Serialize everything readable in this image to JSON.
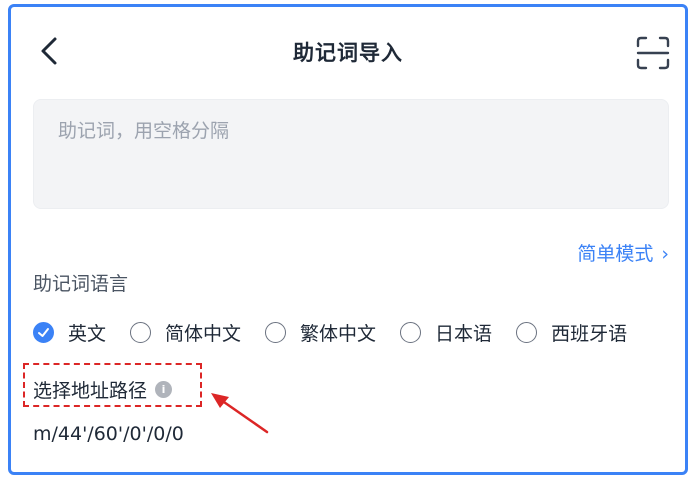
{
  "header": {
    "title": "助记词导入",
    "back_icon": "chevron-left-icon",
    "scan_icon": "scan-icon"
  },
  "mnemonic_input": {
    "placeholder": "助记词，用空格分隔"
  },
  "simple_mode": {
    "label": "简单模式",
    "chevron": "›"
  },
  "language": {
    "label": "助记词语言",
    "options": [
      {
        "label": "英文",
        "selected": true
      },
      {
        "label": "简体中文",
        "selected": false
      },
      {
        "label": "繁体中文",
        "selected": false
      },
      {
        "label": "日本语",
        "selected": false
      },
      {
        "label": "西班牙语",
        "selected": false
      }
    ]
  },
  "address_path": {
    "label": "选择地址路径",
    "info_icon": "info-icon",
    "info_glyph": "i",
    "value": "m/44'/60'/0'/0/0"
  },
  "colors": {
    "accent": "#3b82f6",
    "annotation_red": "#dc2626"
  }
}
